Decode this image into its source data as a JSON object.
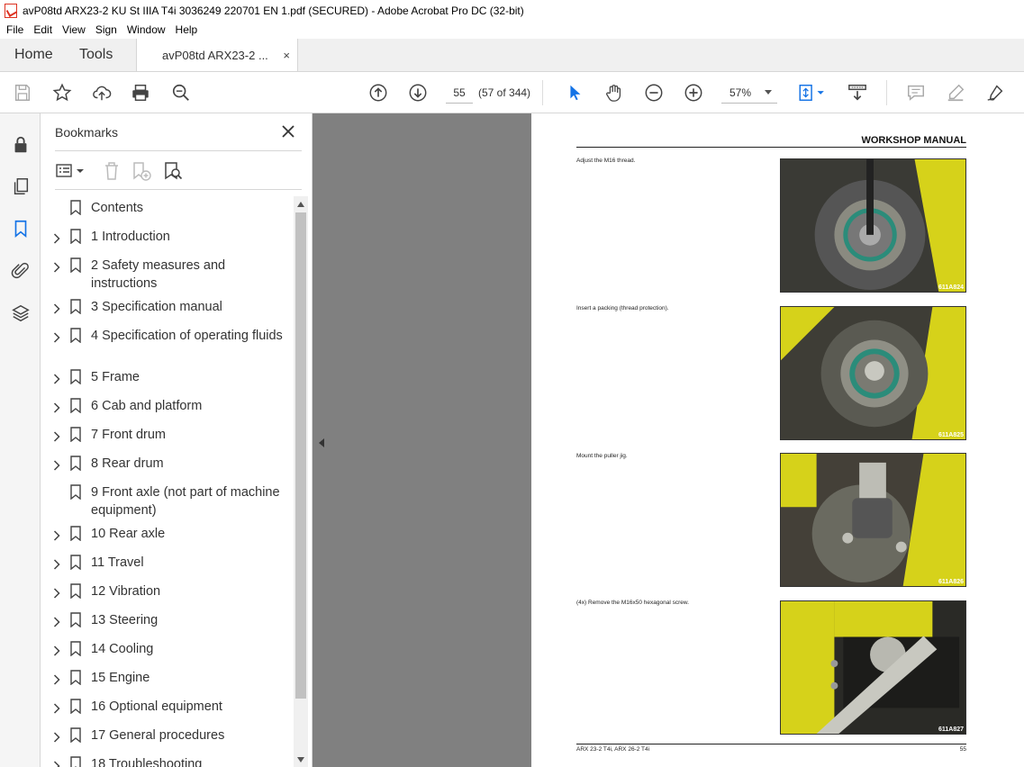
{
  "window": {
    "title": "avP08td ARX23-2 KU St IIIA T4i 3036249 220701 EN 1.pdf (SECURED) - Adobe Acrobat Pro DC (32-bit)"
  },
  "menu": [
    "File",
    "Edit",
    "View",
    "Sign",
    "Window",
    "Help"
  ],
  "tabs": {
    "home": "Home",
    "tools": "Tools",
    "document": "avP08td ARX23-2 ...",
    "close": "×"
  },
  "toolbar": {
    "page_input": "55",
    "page_count": "(57 of 344)",
    "zoom": "57%"
  },
  "bookmarks": {
    "title": "Bookmarks",
    "items": [
      {
        "label": "Contents",
        "expandable": false
      },
      {
        "label": "1 Introduction",
        "expandable": true
      },
      {
        "label": "2 Safety measures and instructions",
        "expandable": true
      },
      {
        "label": "3 Specification manual",
        "expandable": true
      },
      {
        "label": "4 Specification of operating fluids",
        "expandable": true
      },
      {
        "label": "5 Frame",
        "expandable": true
      },
      {
        "label": "6 Cab and platform",
        "expandable": true
      },
      {
        "label": "7 Front drum",
        "expandable": true
      },
      {
        "label": "8 Rear drum",
        "expandable": true
      },
      {
        "label": "9 Front axle (not part of machine equipment)",
        "expandable": false
      },
      {
        "label": "10 Rear axle",
        "expandable": true
      },
      {
        "label": "11 Travel",
        "expandable": true
      },
      {
        "label": "12 Vibration",
        "expandable": true
      },
      {
        "label": "13 Steering",
        "expandable": true
      },
      {
        "label": "14 Cooling",
        "expandable": true
      },
      {
        "label": "15 Engine",
        "expandable": true
      },
      {
        "label": "16 Optional equipment",
        "expandable": true
      },
      {
        "label": "17 General procedures",
        "expandable": true
      },
      {
        "label": "18 Troubleshooting",
        "expandable": true
      }
    ]
  },
  "page": {
    "header": "WORKSHOP MANUAL",
    "steps": [
      {
        "text": "Adjust the M16 thread.",
        "image_code": "611A824"
      },
      {
        "text": "Insert a packing (thread protection).",
        "image_code": "611A825"
      },
      {
        "text": "Mount the puller jig.",
        "image_code": "611A826"
      },
      {
        "text": "(4x) Remove the M16x50 hexagonal screw.",
        "image_code": "611A827"
      }
    ],
    "footer_left": "ARX 23-2 T4i, ARX 26-2 T4i",
    "footer_page": "55"
  },
  "colors": {
    "accent_blue": "#1473e6",
    "machine_yellow": "#e6e01a",
    "doc_background": "#808080"
  }
}
